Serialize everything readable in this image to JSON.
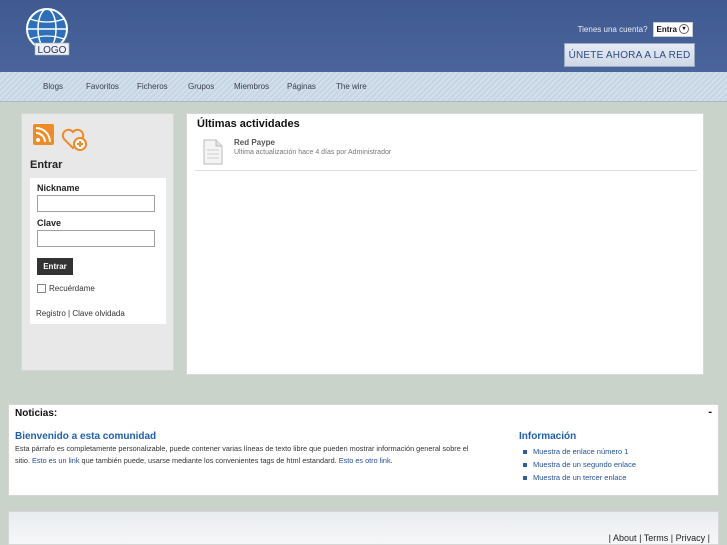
{
  "header": {
    "logo_text": "LOGO",
    "account_question": "Tienes una cuenta?",
    "login_dropdown": "Entra",
    "join_button": "ÚNETE AHORA A LA RED"
  },
  "nav": {
    "items": [
      "Blogs",
      "Favoritos",
      "Ficheros",
      "Grupos",
      "Miembros",
      "Páginas",
      "The wire"
    ]
  },
  "sidebar": {
    "login_title": "Entrar",
    "nickname_label": "Nickname",
    "password_label": "Clave",
    "nickname_value": "",
    "password_value": "",
    "submit_label": "Entrar",
    "remember_label": "Recuérdame",
    "register_link": "Registro",
    "separator": "|",
    "forgot_link": "Clave olvidada"
  },
  "activity": {
    "title": "Últimas actividades",
    "items": [
      {
        "name": "Red Paype",
        "subtitle": "Ultima actualización hace 4 días por Administrador"
      }
    ]
  },
  "news": {
    "title": "Noticias:",
    "toggle": "-",
    "headline": "Bienvenido a esta comunidad",
    "body_1": "Esta párrafo es completamente personalizable, puede contener varias líneas de texto libre que pueden mostrar información general sobre el sitio. ",
    "link_1": "Esto es un link",
    "body_2": " que también puede, usarse mediante los convenientes tags de html estandard. ",
    "link_2": "Esto es otro link",
    "body_3": ".",
    "info_title": "Información",
    "info_links": [
      "Muestra de enlace número 1",
      "Muestra de un segundo enlace",
      "Muestra de un tercer enlace"
    ]
  },
  "footer": {
    "sep": "|",
    "about": "About",
    "terms": "Terms",
    "privacy": "Privacy"
  },
  "colors": {
    "header_bg": "#45609a",
    "link": "#1f5fb0",
    "rss": "#f08a24"
  }
}
